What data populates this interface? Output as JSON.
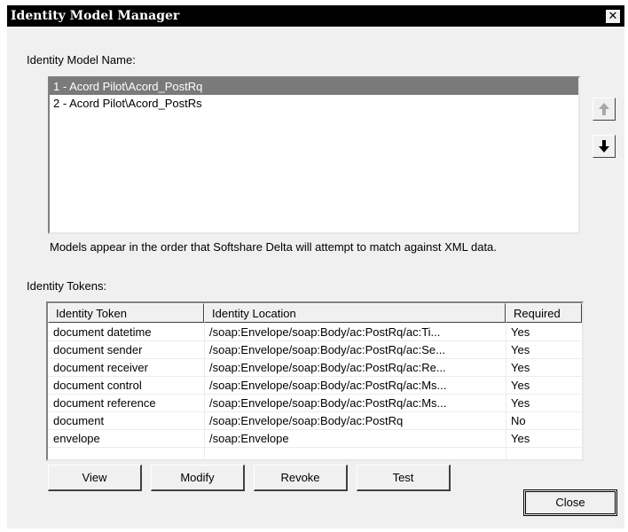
{
  "window": {
    "title": "Identity Model Manager",
    "close_glyph": "✕"
  },
  "models": {
    "label": "Identity Model Name:",
    "items": [
      {
        "label": "1 - Acord Pilot\\Acord_PostRq",
        "selected": true
      },
      {
        "label": "2 - Acord Pilot\\Acord_PostRs",
        "selected": false
      }
    ],
    "note": "Models appear in the order that Softshare Delta will attempt to match against XML data.",
    "move_up_icon": "arrow-up-icon",
    "move_down_icon": "arrow-down-icon"
  },
  "tokens": {
    "label": "Identity Tokens:",
    "columns": [
      "Identity Token",
      "Identity Location",
      "Required"
    ],
    "rows": [
      [
        "document datetime",
        "/soap:Envelope/soap:Body/ac:PostRq/ac:Ti...",
        "Yes"
      ],
      [
        "document sender",
        "/soap:Envelope/soap:Body/ac:PostRq/ac:Se...",
        "Yes"
      ],
      [
        "document receiver",
        "/soap:Envelope/soap:Body/ac:PostRq/ac:Re...",
        "Yes"
      ],
      [
        "document control",
        "/soap:Envelope/soap:Body/ac:PostRq/ac:Ms...",
        "Yes"
      ],
      [
        "document reference",
        "/soap:Envelope/soap:Body/ac:PostRq/ac:Ms...",
        "Yes"
      ],
      [
        "document",
        "/soap:Envelope/soap:Body/ac:PostRq",
        "No"
      ],
      [
        "envelope",
        "/soap:Envelope",
        "Yes"
      ]
    ]
  },
  "buttons": {
    "view": "View",
    "modify": "Modify",
    "revoke": "Revoke",
    "test": "Test",
    "close": "Close"
  }
}
